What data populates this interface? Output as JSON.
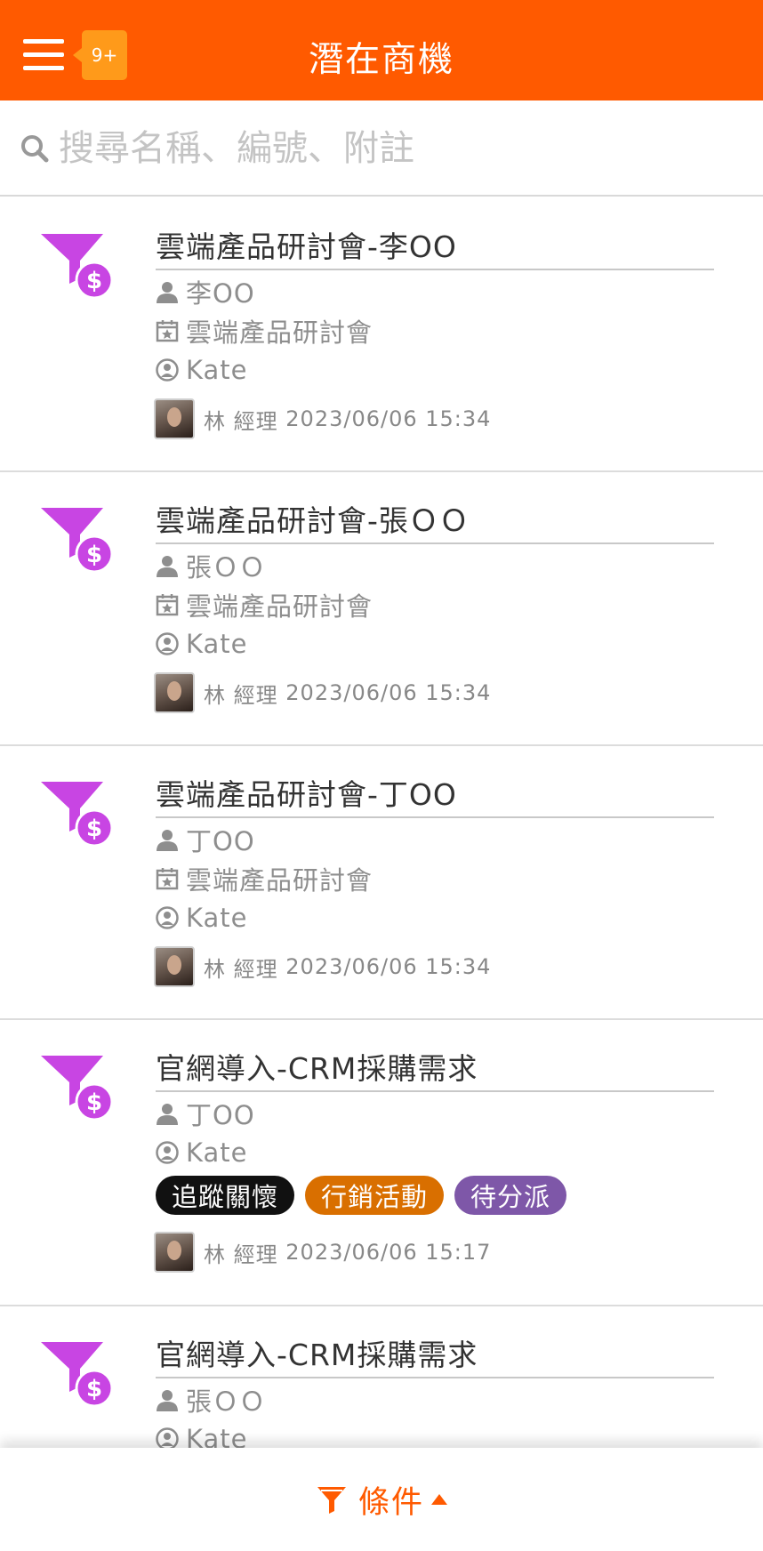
{
  "header": {
    "title": "潛在商機",
    "notification_badge": "9+",
    "accent_color": "#ff5a00"
  },
  "search": {
    "placeholder": "搜尋名稱、編號、附註",
    "value": ""
  },
  "icons": {
    "menu": "hamburger-menu-icon",
    "search": "search-icon",
    "opportunity": "funnel-dollar-icon",
    "contact": "person-icon",
    "campaign": "calendar-star-icon",
    "assignee": "user-circle-icon",
    "filter": "filter-icon"
  },
  "items": [
    {
      "title": "雲端產品研討會-李OO",
      "contact": "李OO",
      "campaign": "雲端產品研討會",
      "assignee": "Kate",
      "creator": "林 經理",
      "timestamp": "2023/06/06 15:34",
      "tags": []
    },
    {
      "title": "雲端產品研討會-張ＯＯ",
      "contact": "張ＯＯ",
      "campaign": "雲端產品研討會",
      "assignee": "Kate",
      "creator": "林 經理",
      "timestamp": "2023/06/06 15:34",
      "tags": []
    },
    {
      "title": "雲端產品研討會-丁OO",
      "contact": "丁OO",
      "campaign": "雲端產品研討會",
      "assignee": "Kate",
      "creator": "林 經理",
      "timestamp": "2023/06/06 15:34",
      "tags": []
    },
    {
      "title": "官網導入-CRM採購需求",
      "contact": "丁OO",
      "campaign": null,
      "assignee": "Kate",
      "creator": "林 經理",
      "timestamp": "2023/06/06 15:17",
      "tags": [
        {
          "label": "追蹤關懷",
          "color": "#111111"
        },
        {
          "label": "行銷活動",
          "color": "#d96f00"
        },
        {
          "label": "待分派",
          "color": "#7e57a8"
        }
      ]
    },
    {
      "title": "官網導入-CRM採購需求",
      "contact": "張ＯＯ",
      "campaign": null,
      "assignee": "Kate",
      "creator": null,
      "timestamp": null,
      "tags": []
    }
  ],
  "bottom_bar": {
    "filter_label": "條件"
  }
}
